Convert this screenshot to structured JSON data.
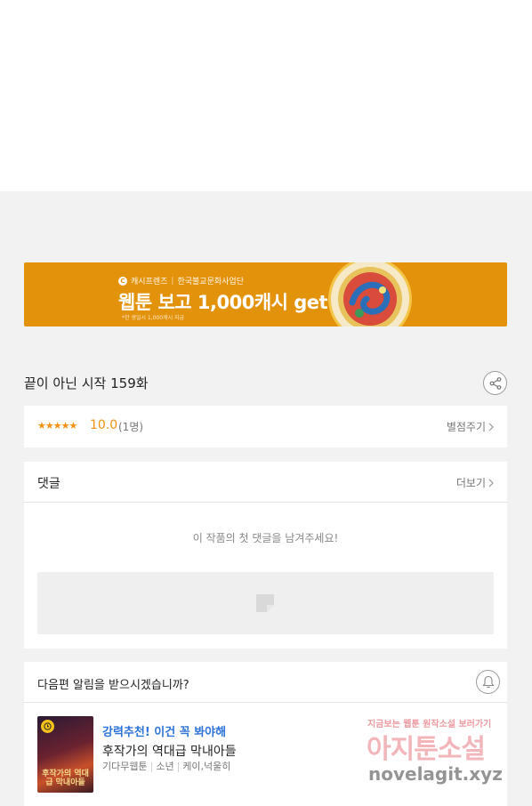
{
  "banner": {
    "brand": "캐시프렌즈",
    "partner": "한국불교문화사업단",
    "headline": "웹툰 보고 1,000캐시 get!",
    "note": "*한 생일시 1,000캐시 지급"
  },
  "episode": {
    "title": "끝이 아닌 시작 159화"
  },
  "rating": {
    "stars": "★★★★★",
    "score": "10.0",
    "count": "(1명)",
    "rate_label": "별점주기"
  },
  "comments": {
    "label": "댓글",
    "more_label": "더보기",
    "empty_message": "이 작품의 첫 댓글을 남겨주세요!"
  },
  "next_episode": {
    "question": "다음편 알림을 받으시겠습니까?",
    "recommendation": {
      "tag": "강력추천! 이건 꼭 봐야해",
      "title": "후작가의 역대급 막내아들",
      "meta": [
        "기다무웹툰",
        "소년",
        "케이,넉울히"
      ],
      "thumb_text": "후작가의 역대급 막내아들"
    }
  },
  "watermark": {
    "line1": "지금보는 웹툰 원작소설 보러가기",
    "line2": "아지툰소설",
    "line3": "novelagit.xyz"
  },
  "colors": {
    "banner_bg": "#e3920c",
    "accent_orange": "#f0910f",
    "link_blue": "#2d73d8"
  }
}
